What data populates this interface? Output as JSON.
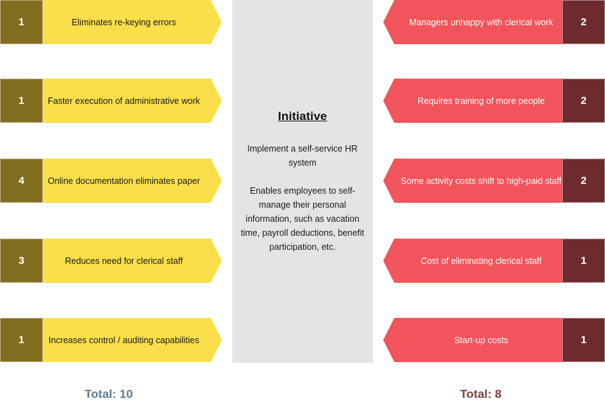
{
  "initiative": {
    "title": "Initiative",
    "summary": "Implement a self-service HR system",
    "description": "Enables employees to self-manage their personal information, such as vacation time, payroll deductions, benefit participation, etc."
  },
  "pros": {
    "items": [
      {
        "score": "1",
        "label": "Eliminates re-keying errors"
      },
      {
        "score": "1",
        "label": "Faster execution of administrative work"
      },
      {
        "score": "4",
        "label": "Online documentation eliminates paper"
      },
      {
        "score": "3",
        "label": "Reduces need for clerical staff"
      },
      {
        "score": "1",
        "label": "Increases control / auditing capabilities"
      }
    ],
    "total_label": "Total: 10"
  },
  "cons": {
    "items": [
      {
        "score": "2",
        "label": "Managers unhappy with clerical work"
      },
      {
        "score": "2",
        "label": "Requires training of more people"
      },
      {
        "score": "2",
        "label": "Some activity costs shift to high-paid staff"
      },
      {
        "score": "1",
        "label": "Cost of eliminating clerical staff"
      },
      {
        "score": "1",
        "label": "Start-up costs"
      }
    ],
    "total_label": "Total: 8"
  },
  "colors": {
    "pro_bar": "#fadf4b",
    "pro_score": "#836d1f",
    "con_bar": "#f2545b",
    "con_score": "#6d2b2e",
    "panel": "#e4e4e4",
    "total_pros": "#5f7d8c",
    "total_cons": "#7b4040"
  }
}
